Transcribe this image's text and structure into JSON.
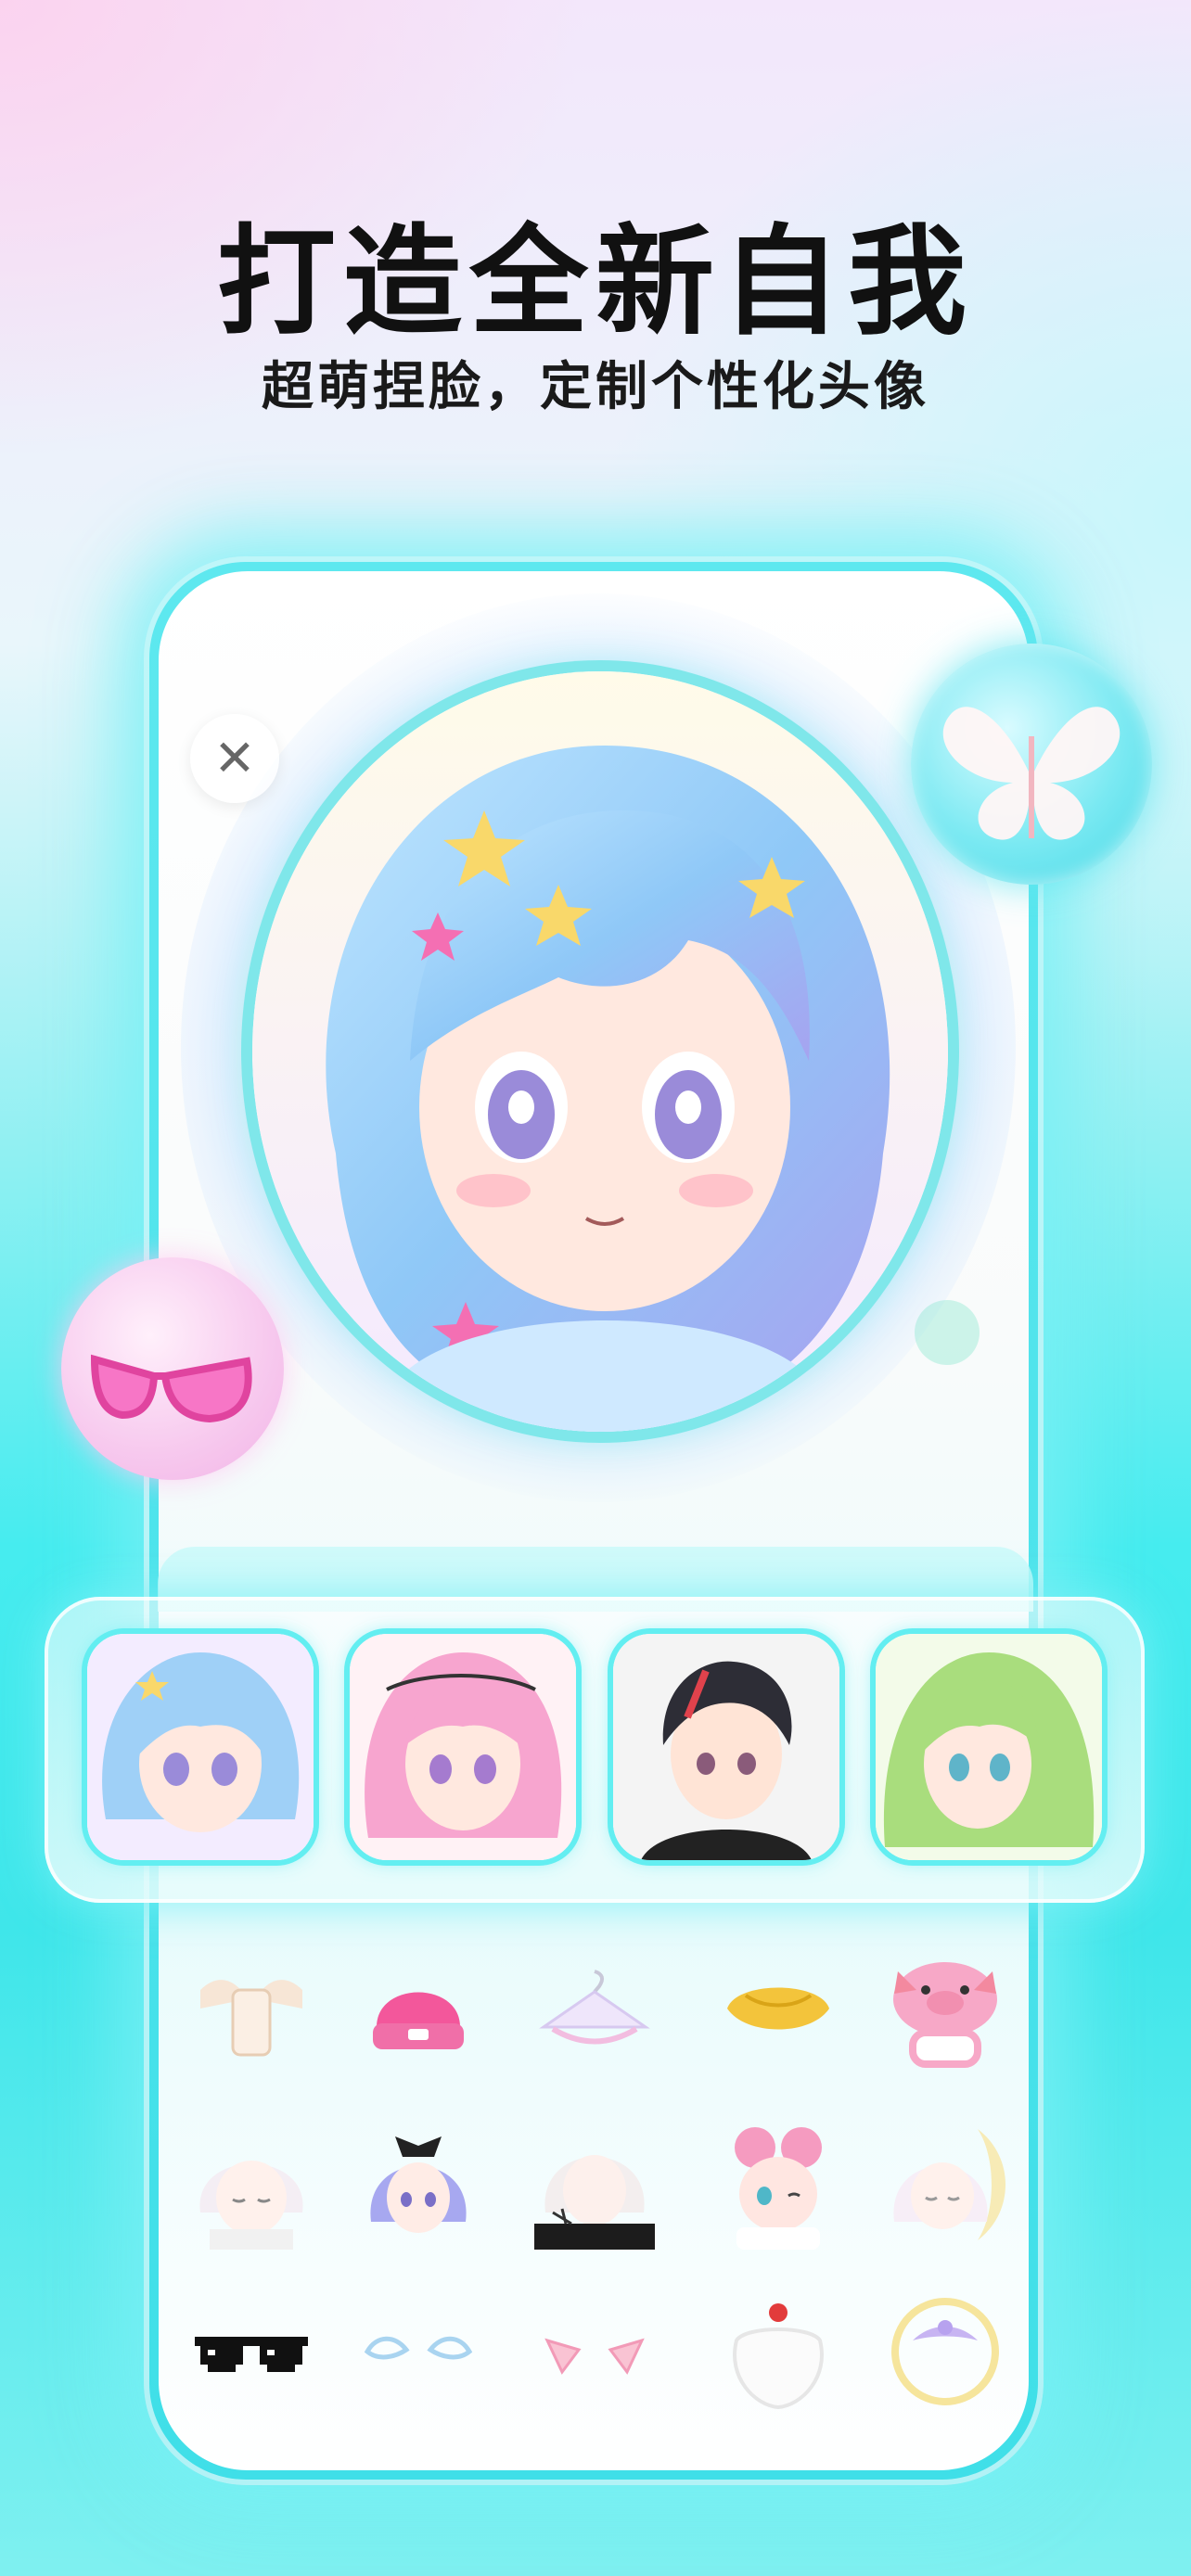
{
  "header": {
    "title": "打造全新自我",
    "subtitle": "超萌捏脸，定制个性化头像"
  },
  "editor": {
    "close_icon": "close-icon",
    "avatar": "anime-girl-avatar",
    "floating_items": [
      "butterfly-icon",
      "sunglasses-icon"
    ]
  },
  "presets": [
    {
      "name": "blue-hair-girl",
      "selected": true
    },
    {
      "name": "pink-hair-girl",
      "selected": false
    },
    {
      "name": "dark-hair-boy",
      "selected": false
    },
    {
      "name": "green-hair-girl",
      "selected": false
    }
  ],
  "items_grid": [
    [
      "winged-outfit-icon",
      "pink-beanie-icon",
      "hanger-outfit-icon",
      "yellow-hat-icon",
      "pig-mask-icon"
    ],
    [
      "white-hair-boy-icon",
      "purple-hair-girl-icon",
      "white-hair-goth-icon",
      "pink-bun-girl-icon",
      "sleeping-girl-icon"
    ],
    [
      "pixel-sunglasses-icon",
      "angel-wings-icon",
      "cat-ears-icon",
      "santa-beard-icon",
      "moon-halo-icon"
    ]
  ],
  "colors": {
    "accent": "#46ecef",
    "pink": "#f48ccf",
    "title": "#111111"
  }
}
